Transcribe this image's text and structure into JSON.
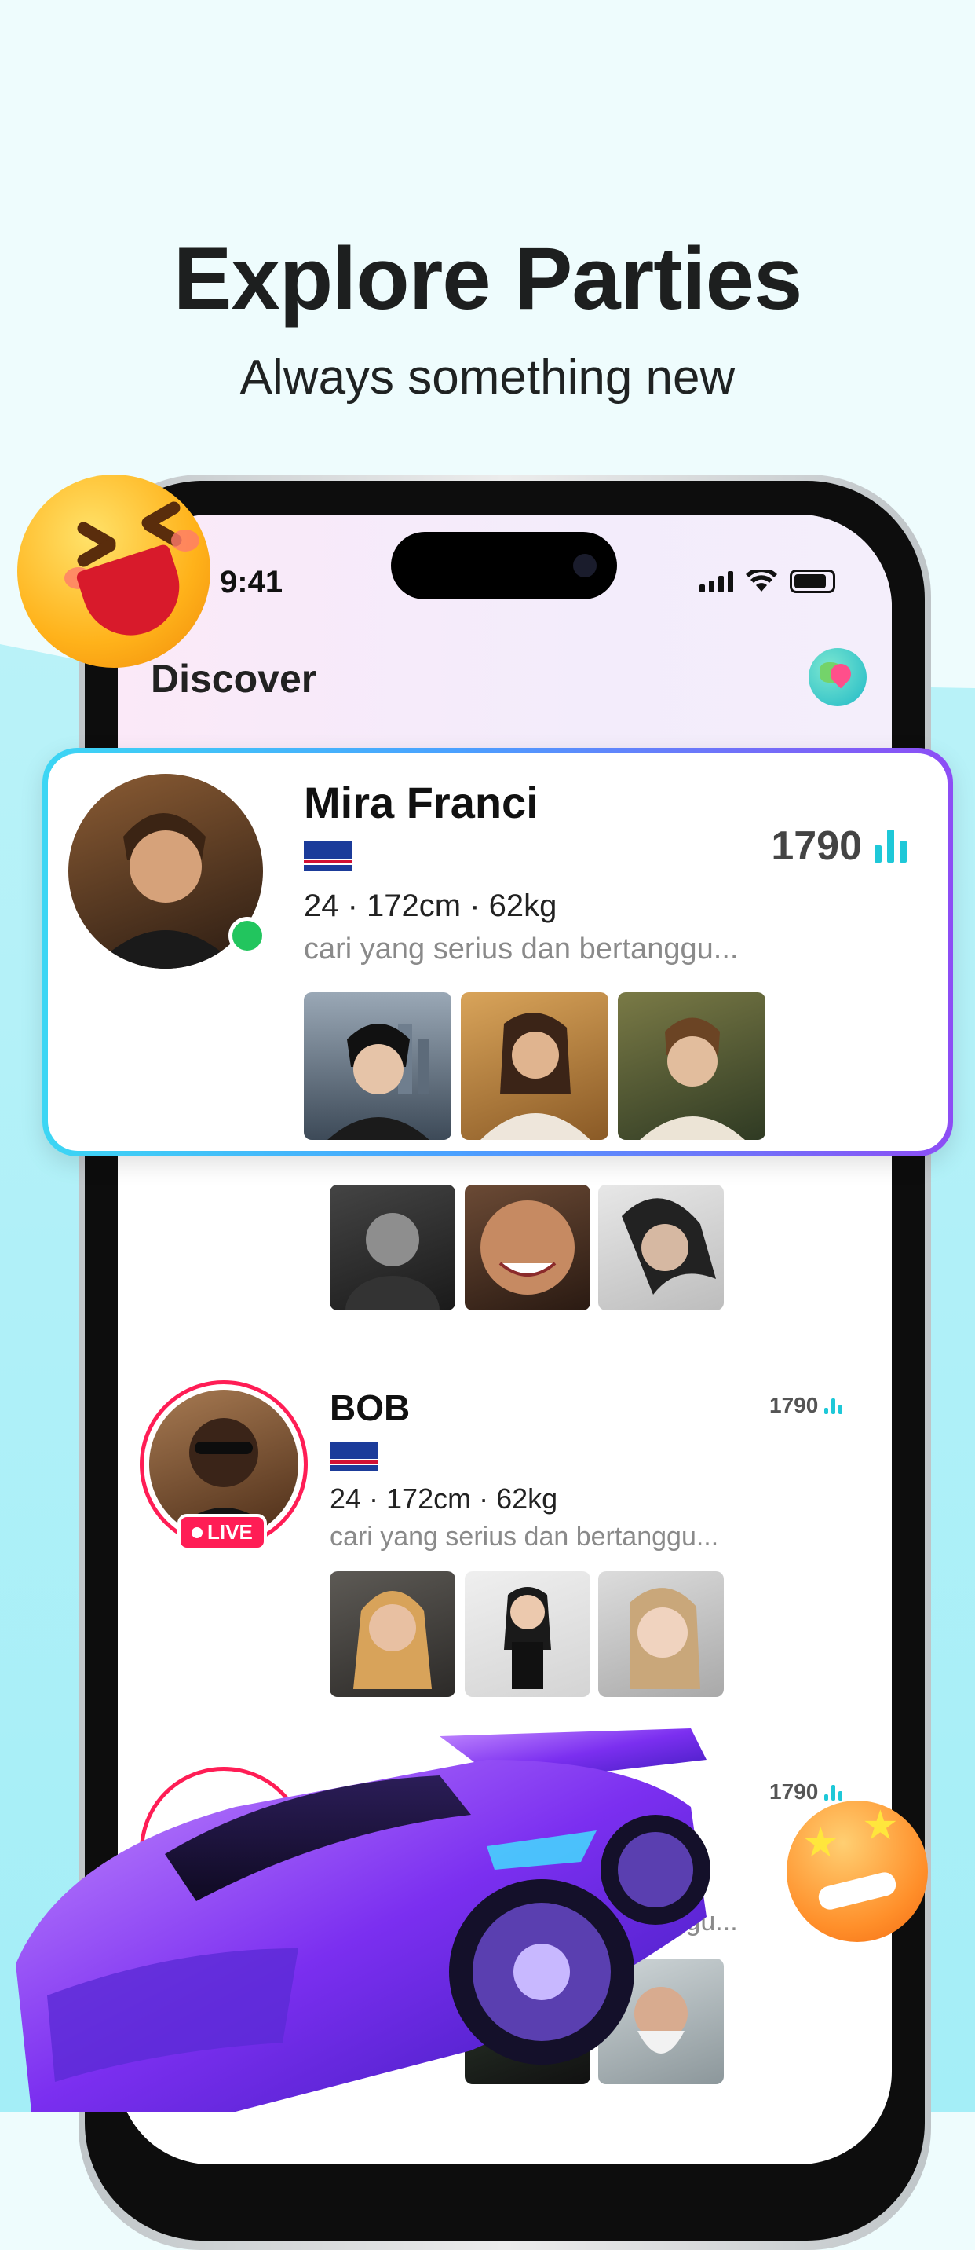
{
  "banner": {
    "title": "Explore Parties",
    "subtitle": "Always something new"
  },
  "status_bar": {
    "time": "9:41"
  },
  "header": {
    "title": "Discover",
    "globe_icon": "globe-location-icon"
  },
  "featured_card": {
    "name": "Mira Franci",
    "flag": "cape-verde-flag",
    "stats": "24 · 172cm · 62kg",
    "bio": "cari yang serius dan bertanggu...",
    "score": "1790",
    "online": true
  },
  "list": [
    {
      "name": "BOB",
      "flag": "cape-verde-flag",
      "stats": "24 · 172cm · 62kg",
      "bio": "cari yang serius dan bertanggu...",
      "score": "1790",
      "live_label": "LIVE"
    },
    {
      "score": "1790",
      "bio_fragment": "dan bertanggu..."
    }
  ],
  "colors": {
    "accent_cyan": "#1ec8d8",
    "live_red": "#ff1d55",
    "online_green": "#22c55e",
    "card_gradient_start": "#3cd6f4",
    "card_gradient_end": "#8d4df5"
  }
}
